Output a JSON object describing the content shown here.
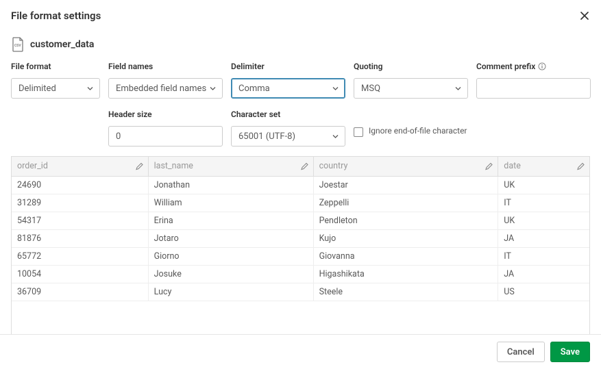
{
  "header": {
    "title": "File format settings"
  },
  "file": {
    "name": "customer_data"
  },
  "labels": {
    "file_format": "File format",
    "field_names": "Field names",
    "delimiter": "Delimiter",
    "quoting": "Quoting",
    "comment_prefix": "Comment prefix",
    "header_size": "Header size",
    "character_set": "Character set",
    "ignore_eof": "Ignore end-of-file character"
  },
  "values": {
    "file_format": "Delimited",
    "field_names": "Embedded field names",
    "delimiter": "Comma",
    "quoting": "MSQ",
    "comment_prefix": "",
    "header_size": "0",
    "character_set": "65001 (UTF-8)"
  },
  "table": {
    "headers": [
      "order_id",
      "last_name",
      "country",
      "date"
    ],
    "rows": [
      [
        "24690",
        "Jonathan",
        "Joestar",
        "UK"
      ],
      [
        "31289",
        "William",
        "Zeppelli",
        "IT"
      ],
      [
        "54317",
        "Erina",
        "Pendleton",
        "UK"
      ],
      [
        "81876",
        "Jotaro",
        "Kujo",
        "JA"
      ],
      [
        "65772",
        "Giorno",
        "Giovanna",
        "IT"
      ],
      [
        "10054",
        "Josuke",
        "Higashikata",
        "JA"
      ],
      [
        "36709",
        "Lucy",
        "Steele",
        "US"
      ]
    ]
  },
  "footer": {
    "cancel": "Cancel",
    "save": "Save"
  }
}
